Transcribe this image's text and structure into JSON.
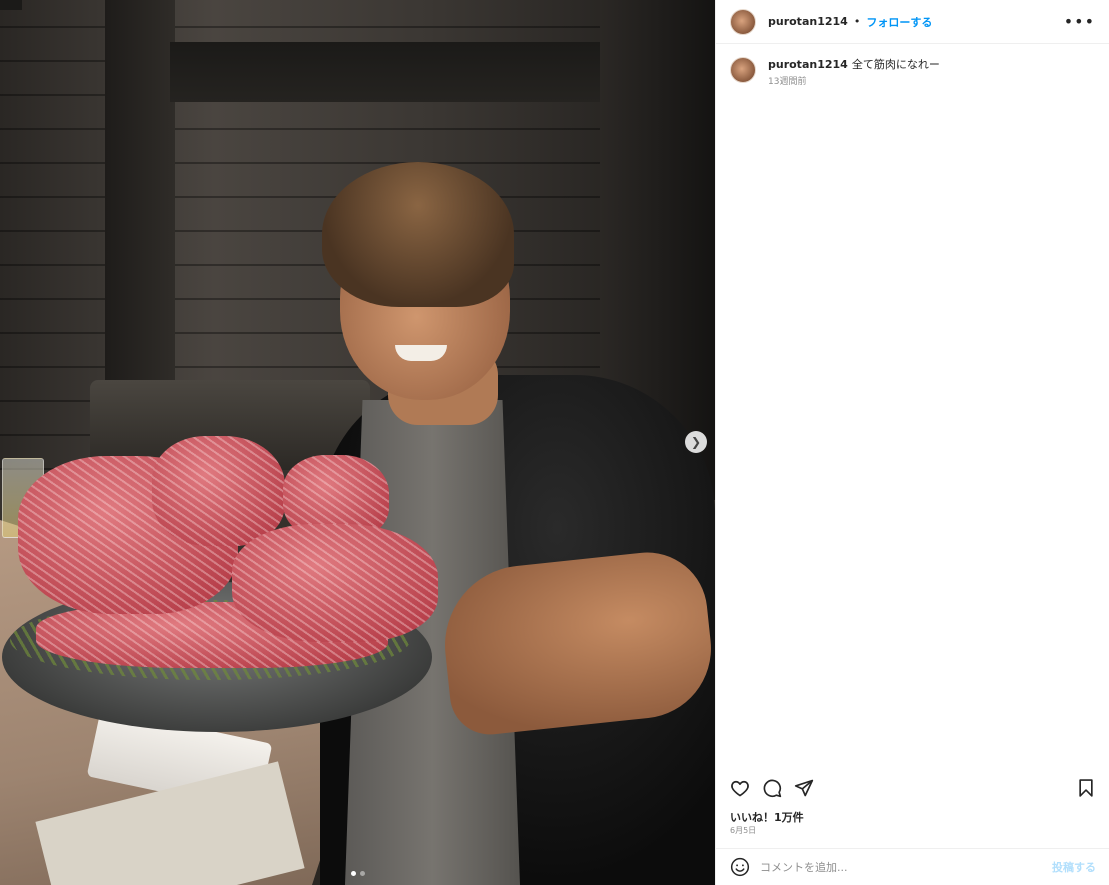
{
  "post": {
    "username": "purotan1214",
    "separator": "•",
    "follow_label": "フォローする",
    "more_icon": "more-horizontal-icon",
    "caption_user": "purotan1214",
    "caption_text": "全て筋肉になれー",
    "caption_time": "13週間前",
    "likes": "いいね！1万件",
    "date": "6月5日",
    "comment_placeholder": "コメントを追加...",
    "post_label": "投稿する",
    "media_alt": "Man holding a large platter of raw wagyu beef blocks",
    "carousel_count": 2,
    "carousel_index": 0
  },
  "colors": {
    "accent": "#0095f6",
    "post_button_disabled": "#b2dffc",
    "text": "#262626",
    "muted": "#8e8e8e"
  }
}
